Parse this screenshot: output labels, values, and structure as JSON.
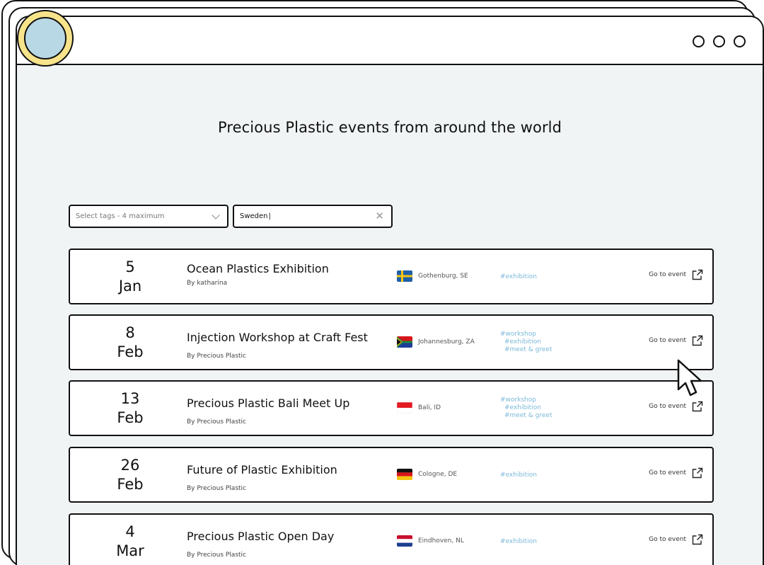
{
  "page": {
    "title": "Precious Plastic events from around the world"
  },
  "filters": {
    "tags_placeholder": "Select tags - 4 maximum",
    "search_value": "Sweden"
  },
  "events": [
    {
      "day": "5",
      "month": "Jan",
      "title": "Ocean Plastics Exhibition",
      "author": "By katharina",
      "flag": "se-flag-icon",
      "location": "Gothenburg, SE",
      "tags": [
        "#exhibition"
      ],
      "cta": "Go to event"
    },
    {
      "day": "8",
      "month": "Feb",
      "title": "Injection Workshop at Craft Fest",
      "author": "By Precious Plastic",
      "flag": "za-flag-icon",
      "location": "Johannesburg, ZA",
      "tags": [
        "#workshop",
        "#exhibition",
        "#meet & greet"
      ],
      "cta": "Go to event"
    },
    {
      "day": "13",
      "month": "Feb",
      "title": "Precious Plastic Bali Meet Up",
      "author": "By Precious Plastic",
      "flag": "id-flag-icon",
      "location": "Bali, ID",
      "tags": [
        "#workshop",
        "#exhibition",
        "#meet & greet"
      ],
      "cta": "Go to event"
    },
    {
      "day": "26",
      "month": "Feb",
      "title": "Future of Plastic Exhibition",
      "author": "By Precious Plastic",
      "flag": "de-flag-icon",
      "location": "Cologne, DE",
      "tags": [
        "#exhibition"
      ],
      "cta": "Go to event"
    },
    {
      "day": "4",
      "month": "Mar",
      "title": "Precious Plastic Open Day",
      "author": "By Precious Plastic",
      "flag": "nl-flag-icon",
      "location": "Eindhoven, NL",
      "tags": [
        "#exhibition"
      ],
      "cta": "Go to event"
    }
  ],
  "colors": {
    "window_bg": "#f1f4f4",
    "logo_outer": "#f7e38a",
    "logo_inner": "#b9d8e6",
    "tag": "#7ab8d8"
  },
  "icons": {
    "dropdown": "chevron-down-icon",
    "clear": "close-icon",
    "external": "external-link-icon",
    "pointer": "mouse-pointer-icon"
  }
}
